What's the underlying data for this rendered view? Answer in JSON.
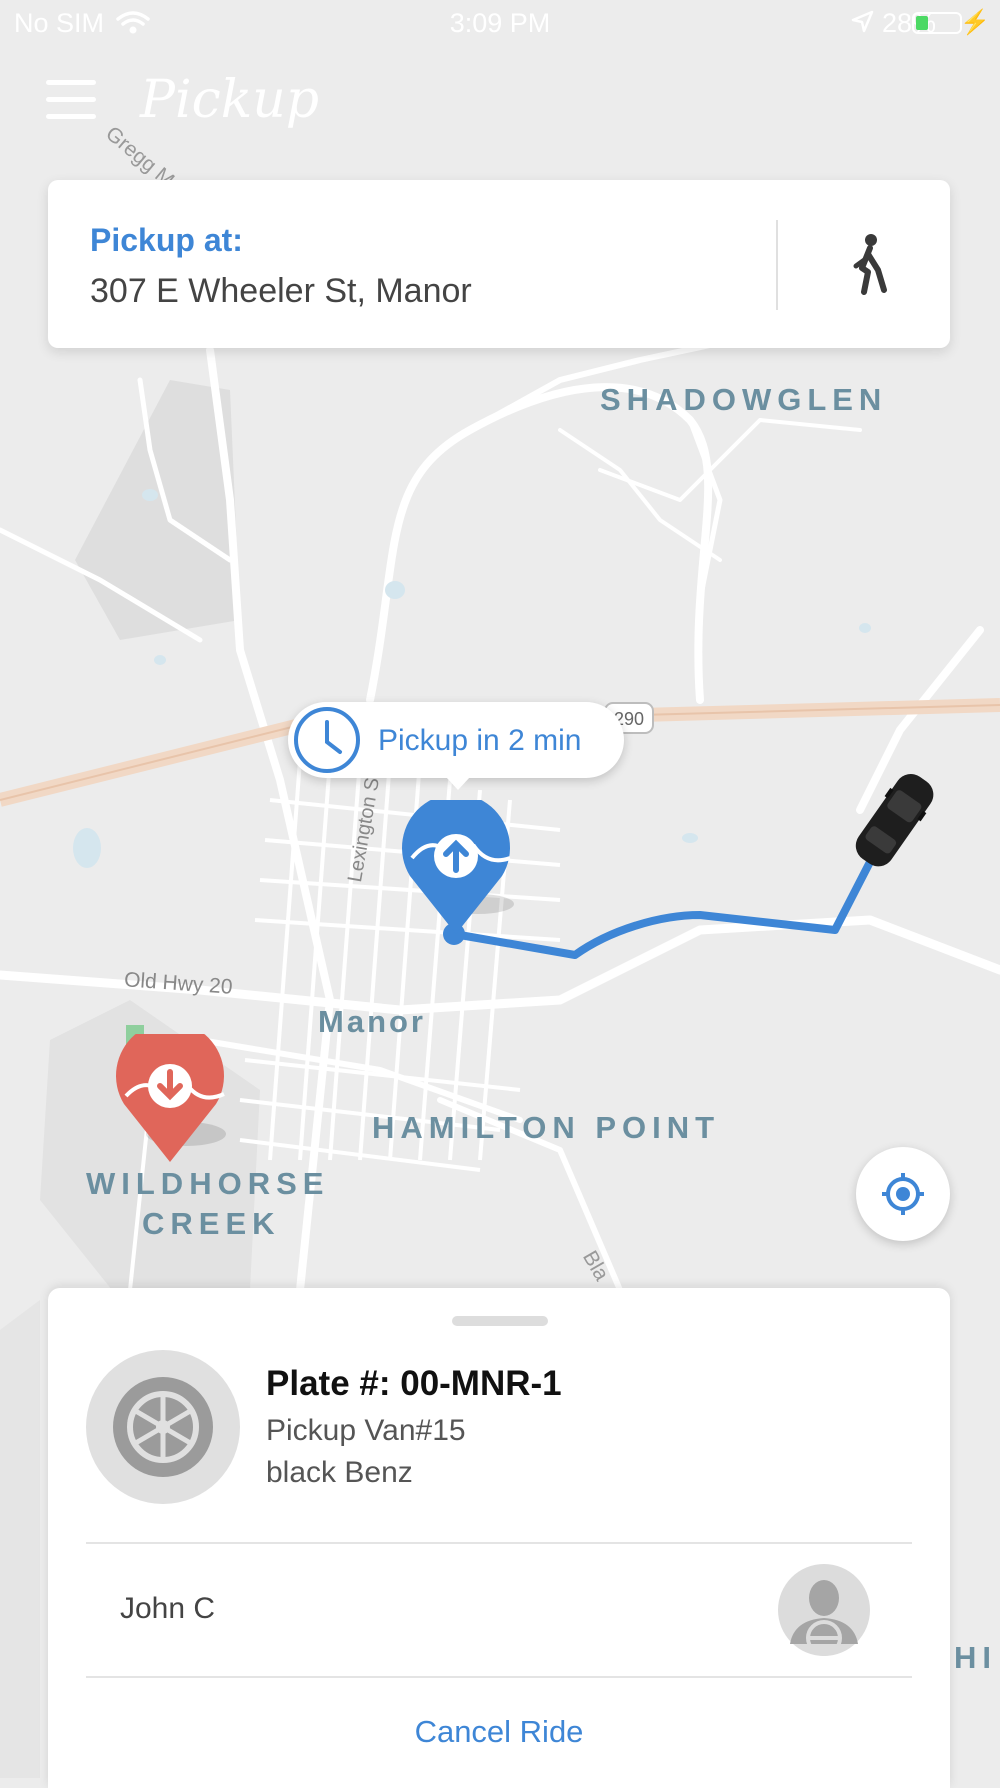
{
  "status_bar": {
    "carrier": "No SIM",
    "time": "3:09 PM",
    "battery": "28%",
    "battery_level": 0.28
  },
  "header": {
    "app_title": "Pickup",
    "menu_icon": "hamburger-menu-icon"
  },
  "pickup_card": {
    "label": "Pickup at:",
    "address": "307 E Wheeler St, Manor",
    "walk_icon": "walking-person-icon"
  },
  "map": {
    "labels": {
      "shadowglen": "SHADOWGLEN",
      "manor": "Manor",
      "hamilton_point": "HAMILTON POINT",
      "wildhorse_1": "WILDHORSE",
      "wildhorse_2": "CREEK",
      "old_hwy": "Old Hwy 20",
      "lexington": "Lexington St",
      "gregg": "Gregg M",
      "highway_shield": "290",
      "bla": "Bla",
      "hi": "HI"
    },
    "eta_text": "Pickup in 2 min",
    "pickup_pin_icon": "pickup-pin-icon",
    "dropoff_pin_icon": "dropoff-pin-icon",
    "car_icon": "car-icon",
    "route_color": "#3e86d6"
  },
  "driver_sheet": {
    "plate": "Plate #: 00-MNR-1",
    "vehicle_model": "Pickup Van#15",
    "vehicle_color": "black Benz",
    "driver_name": "John C",
    "cancel_label": "Cancel Ride"
  },
  "colors": {
    "accent": "#3e86d6",
    "dropoff": "#e0665a",
    "map_background": "#ececec"
  }
}
